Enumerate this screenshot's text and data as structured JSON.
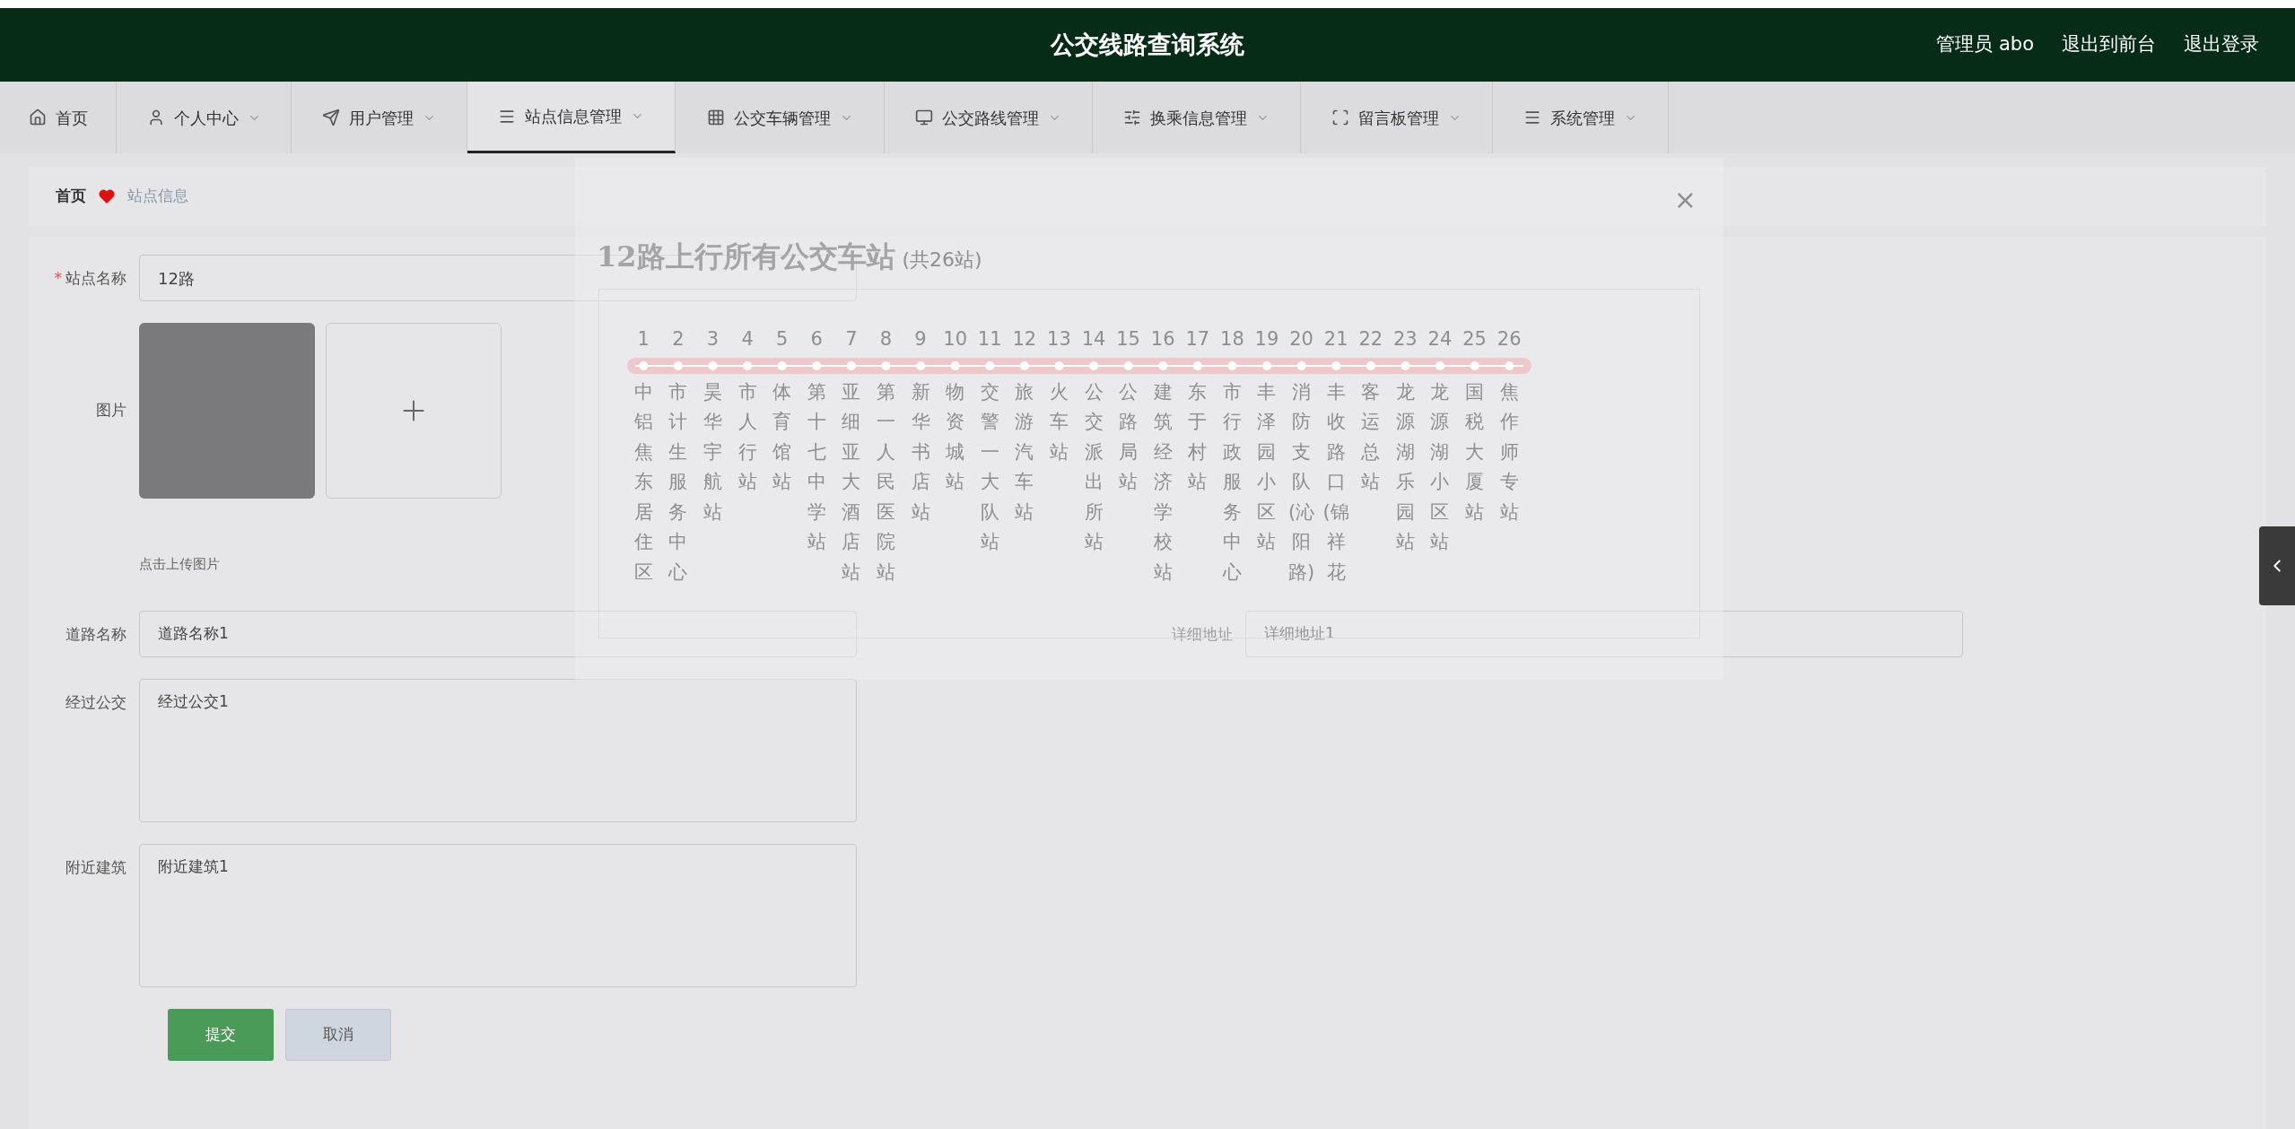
{
  "header": {
    "title": "公交线路查询系统",
    "links": [
      "管理员 abo",
      "退出到前台",
      "退出登录"
    ]
  },
  "nav": [
    {
      "label": "首页",
      "selected": false,
      "dropdown": false
    },
    {
      "label": "个人中心",
      "selected": false,
      "dropdown": true
    },
    {
      "label": "用户管理",
      "selected": false,
      "dropdown": true
    },
    {
      "label": "站点信息管理",
      "selected": true,
      "dropdown": true
    },
    {
      "label": "公交车辆管理",
      "selected": false,
      "dropdown": true
    },
    {
      "label": "公交路线管理",
      "selected": false,
      "dropdown": true
    },
    {
      "label": "换乘信息管理",
      "selected": false,
      "dropdown": true
    },
    {
      "label": "留言板管理",
      "selected": false,
      "dropdown": true
    },
    {
      "label": "系统管理",
      "selected": false,
      "dropdown": true
    }
  ],
  "breadcrumb": {
    "home": "首页",
    "current": "站点信息"
  },
  "form": {
    "station_name": {
      "label": "站点名称",
      "required_mark": "*",
      "value": "12路"
    },
    "image": {
      "label": "图片",
      "hint": "点击上传图片"
    },
    "road_name": {
      "label": "道路名称",
      "value": "道路名称1"
    },
    "address": {
      "label": "详细地址",
      "value": "详细地址1"
    },
    "buses": {
      "label": "经过公交",
      "value": "经过公交1"
    },
    "nearby": {
      "label": "附近建筑",
      "value": "附近建筑1"
    },
    "buttons": [
      "提交",
      "取消"
    ]
  },
  "preview": {
    "close": "×",
    "title": "12路上行所有公交车站",
    "count": "(共26站)",
    "stops": [
      {
        "number": "1",
        "name": "中铝焦东居住区"
      },
      {
        "number": "2",
        "name": "市计生服务中心"
      },
      {
        "number": "3",
        "name": "昊华宇航站"
      },
      {
        "number": "4",
        "name": "市人行站"
      },
      {
        "number": "5",
        "name": "体育馆站"
      },
      {
        "number": "6",
        "name": "第十七中学站"
      },
      {
        "number": "7",
        "name": "亚细亚大酒店站"
      },
      {
        "number": "8",
        "name": "第一人民医院站"
      },
      {
        "number": "9",
        "name": "新华书店站"
      },
      {
        "number": "10",
        "name": "物资城站"
      },
      {
        "number": "11",
        "name": "交警一大队站"
      },
      {
        "number": "12",
        "name": "旅游汽车站"
      },
      {
        "number": "13",
        "name": "火车站"
      },
      {
        "number": "14",
        "name": "公交派出所站"
      },
      {
        "number": "15",
        "name": "公路局站"
      },
      {
        "number": "16",
        "name": "建筑经济学校站"
      },
      {
        "number": "17",
        "name": "东于村站"
      },
      {
        "number": "18",
        "name": "市行政服务中心"
      },
      {
        "number": "19",
        "name": "丰泽园小区站"
      },
      {
        "number": "20",
        "name": "消防支队(沁阳路)"
      },
      {
        "number": "21",
        "name": "丰收路口(锦祥花"
      },
      {
        "number": "22",
        "name": "客运总站"
      },
      {
        "number": "23",
        "name": "龙源湖乐园站"
      },
      {
        "number": "24",
        "name": "龙源湖小区站"
      },
      {
        "number": "25",
        "name": "国税大厦站"
      },
      {
        "number": "26",
        "name": "焦作师专站"
      }
    ]
  }
}
